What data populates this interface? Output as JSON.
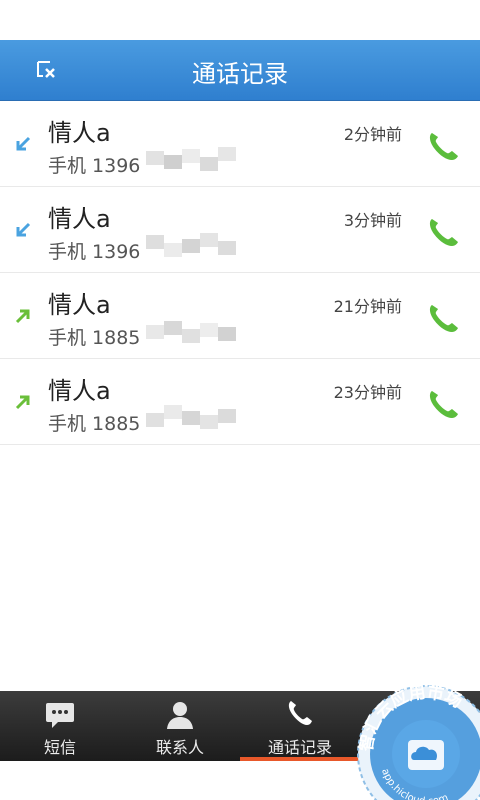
{
  "header": {
    "title": "通话记录",
    "clear_icon": "clear-list-icon"
  },
  "calls": [
    {
      "name": "情人a",
      "number": "手机 1396",
      "time": "2分钟前",
      "direction": "incoming"
    },
    {
      "name": "情人a",
      "number": "手机 1396",
      "time": "3分钟前",
      "direction": "incoming"
    },
    {
      "name": "情人a",
      "number": "手机 1885",
      "time": "21分钟前",
      "direction": "outgoing"
    },
    {
      "name": "情人a",
      "number": "手机 1885",
      "time": "23分钟前",
      "direction": "outgoing"
    }
  ],
  "tabs": [
    {
      "label": "短信",
      "icon": "message-icon"
    },
    {
      "label": "联系人",
      "icon": "contact-icon"
    },
    {
      "label": "通话记录",
      "icon": "phone-icon",
      "active": true
    },
    {
      "label": "",
      "icon": ""
    }
  ],
  "colors": {
    "header": "#3a8ad8",
    "incoming": "#4aa3e0",
    "outgoing": "#6abf3a",
    "call_green": "#5bbd3c",
    "tab_active": "#e8582a"
  },
  "watermark": {
    "text": "智汇云应用市场",
    "url": "app.hicloud.com"
  }
}
